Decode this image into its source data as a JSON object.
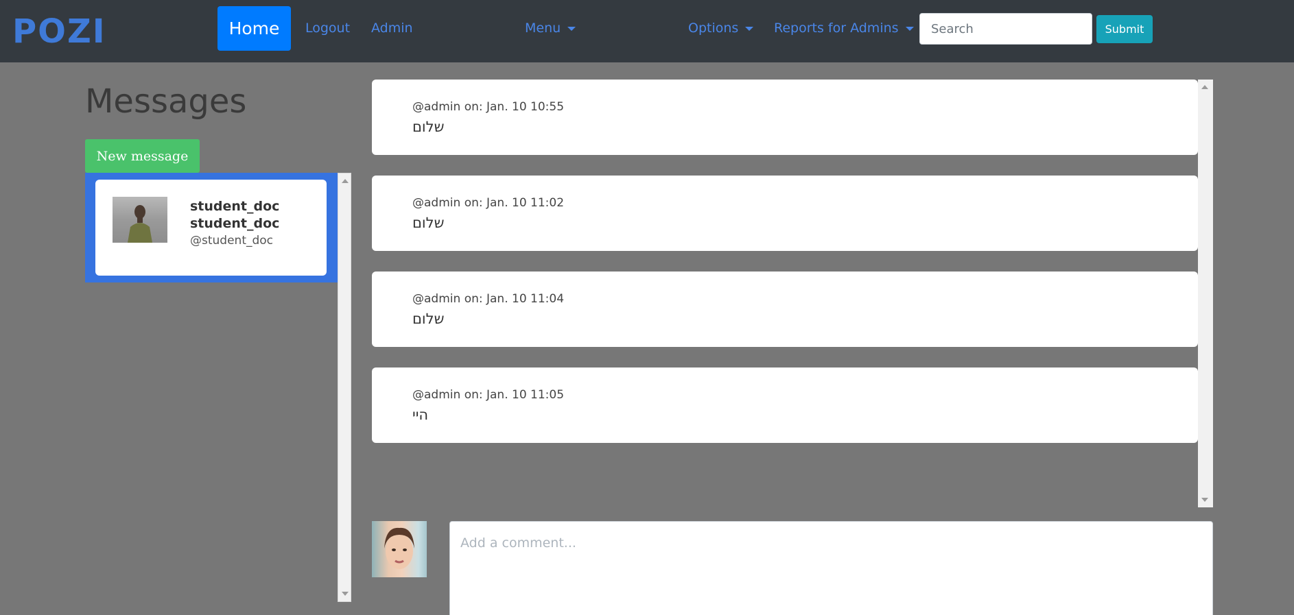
{
  "navbar": {
    "logo": "POZI",
    "home": "Home",
    "logout": "Logout",
    "admin": "Admin",
    "menu": "Menu",
    "options": "Options",
    "reports": "Reports for Admins",
    "search_placeholder": "Search",
    "submit": "Submit"
  },
  "page": {
    "title": "Messages",
    "new_message": "New message"
  },
  "conversation": {
    "name": "student_doc student_doc",
    "handle": "@student_doc"
  },
  "messages": [
    {
      "author": "@admin",
      "on": "on:",
      "date": "Jan. 10 10:55",
      "text": "שלום"
    },
    {
      "author": "@admin",
      "on": "on:",
      "date": "Jan. 10 11:02",
      "text": "שלום"
    },
    {
      "author": "@admin",
      "on": "on:",
      "date": "Jan. 10 11:04",
      "text": "שלום"
    },
    {
      "author": "@admin",
      "on": "on:",
      "date": "Jan. 10 11:05",
      "text": "היי"
    }
  ],
  "comment": {
    "placeholder": "Add a comment..."
  },
  "colors": {
    "navbar": "#343a40",
    "brand": "#3f7ad8",
    "primary": "#007bff",
    "success": "#4ac26b",
    "info": "#17a2b8",
    "selected_panel": "#3673e0"
  }
}
